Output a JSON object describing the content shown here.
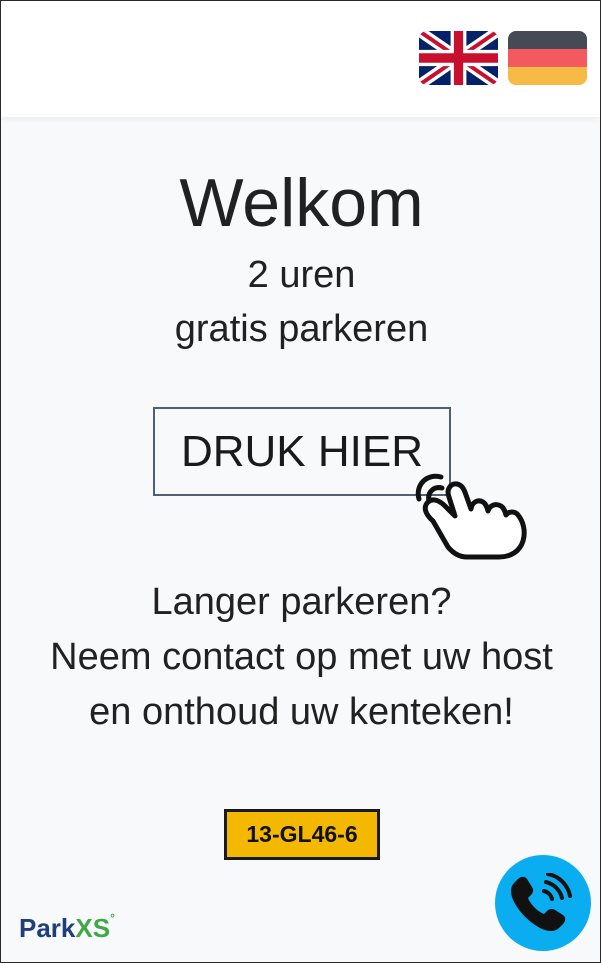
{
  "languages": [
    {
      "code": "en",
      "icon": "uk-flag-icon"
    },
    {
      "code": "de",
      "icon": "germany-flag-icon"
    }
  ],
  "welcome": {
    "title": "Welkom",
    "line1": "2 uren",
    "line2": "gratis parkeren"
  },
  "action": {
    "button_label": "DRUK HIER",
    "hand_icon": "pointing-hand-icon"
  },
  "info": {
    "line1": "Langer parkeren?",
    "line2": "Neem contact op met uw host",
    "line3": "en onthoud uw kenteken!"
  },
  "license_plate": "13-GL46-6",
  "brand": {
    "part1": "Park",
    "part2": "XS",
    "mark": "°"
  },
  "call": {
    "icon": "phone-call-icon"
  },
  "colors": {
    "plate": "#f5b800",
    "call_button": "#0aaef0",
    "brand_blue": "#1f3e7a",
    "brand_green": "#40a845"
  }
}
